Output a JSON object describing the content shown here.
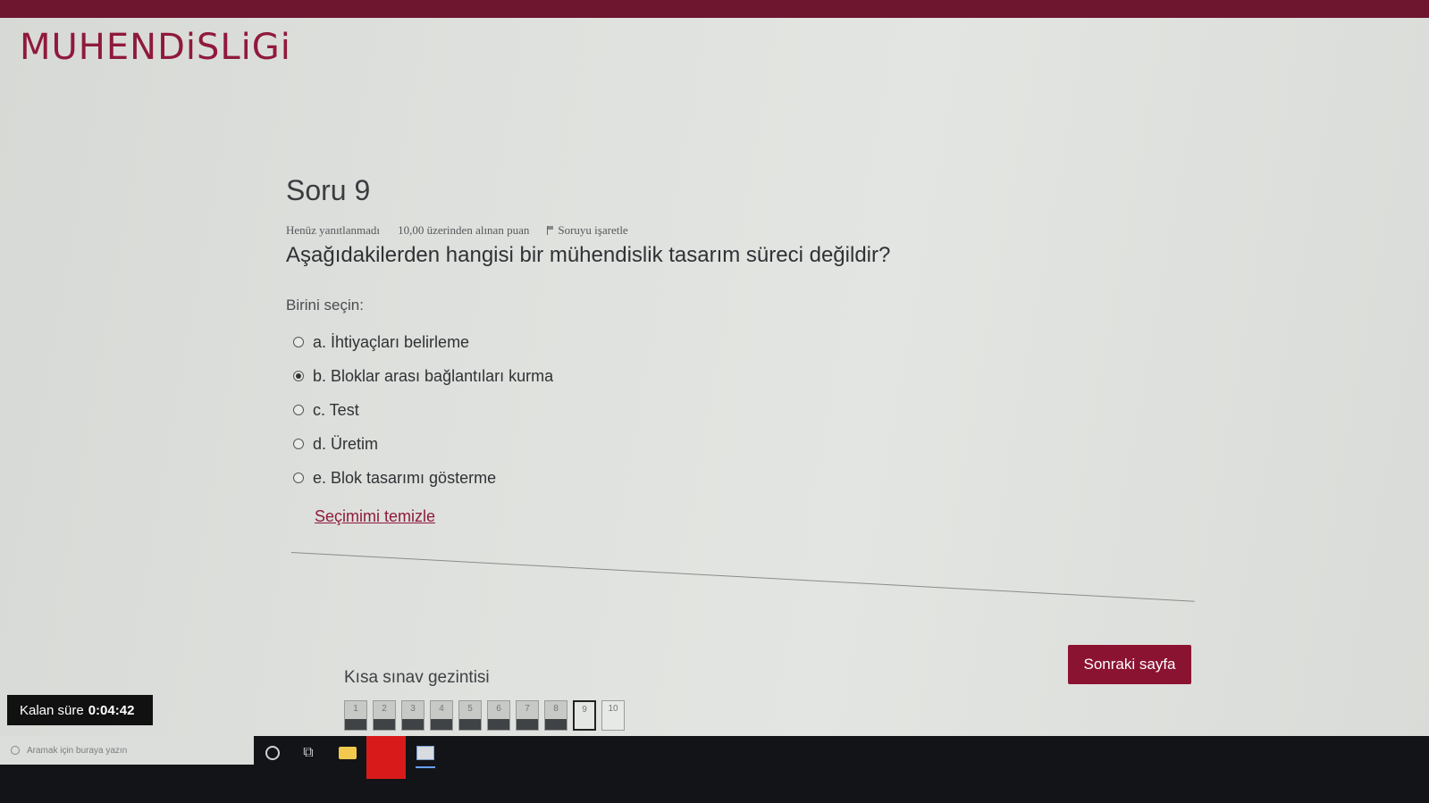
{
  "brand": "MUHENDiSLiGi",
  "question": {
    "title": "Soru 9",
    "status": "Henüz yanıtlanmadı",
    "points": "10,00 üzerinden alınan puan",
    "flag_label": "Soruyu işaretle",
    "text": "Aşağıdakilerden hangisi bir mühendislik tasarım süreci değildir?",
    "choose_label": "Birini seçin:",
    "options": [
      {
        "label": "a. İhtiyaçları belirleme",
        "selected": false
      },
      {
        "label": "b. Bloklar arası bağlantıları kurma",
        "selected": true
      },
      {
        "label": "c. Test",
        "selected": false
      },
      {
        "label": "d. Üretim",
        "selected": false
      },
      {
        "label": "e. Blok tasarımı gösterme",
        "selected": false
      }
    ],
    "clear_link": "Seçimimi temizle"
  },
  "next_button": "Sonraki sayfa",
  "navigation": {
    "title": "Kısa sınav gezintisi",
    "blocks": [
      {
        "num": "1",
        "state": "answered"
      },
      {
        "num": "2",
        "state": "answered"
      },
      {
        "num": "3",
        "state": "answered"
      },
      {
        "num": "4",
        "state": "answered"
      },
      {
        "num": "5",
        "state": "answered"
      },
      {
        "num": "6",
        "state": "answered"
      },
      {
        "num": "7",
        "state": "answered"
      },
      {
        "num": "8",
        "state": "answered"
      },
      {
        "num": "9",
        "state": "current"
      },
      {
        "num": "10",
        "state": "empty"
      }
    ]
  },
  "timer": {
    "label": "Kalan süre",
    "value": "0:04:42"
  },
  "taskbar": {
    "search_placeholder": "Aramak için buraya yazın"
  },
  "colors": {
    "brand": "#8f1a3c",
    "topbar": "#6e1530",
    "button": "#8b1332"
  }
}
